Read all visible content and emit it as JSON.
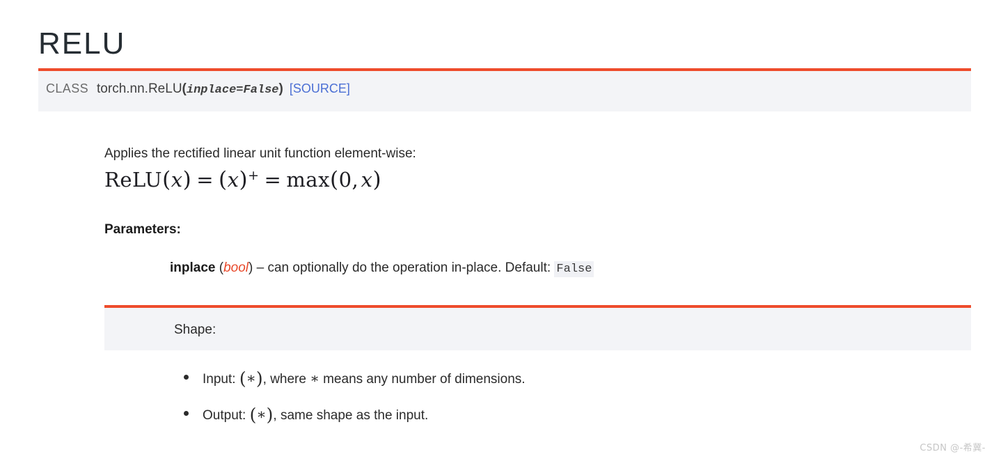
{
  "page": {
    "title": "RELU"
  },
  "signature": {
    "keyword": "CLASS",
    "path": "torch.nn.ReLU",
    "paren_open": "(",
    "argument": "inplace=False",
    "paren_close": ")",
    "source_link": "[SOURCE]"
  },
  "body": {
    "description": "Applies the rectified linear unit function element-wise:",
    "formula": {
      "lhs": "ReLU",
      "lhs_paren_open": "(",
      "lhs_var": "x",
      "lhs_paren_close": ")",
      "eq1": "=",
      "mid_paren_open": "(",
      "mid_var": "x",
      "mid_paren_close": ")",
      "mid_sup": "+",
      "eq2": "=",
      "rhs_fn": "max",
      "rhs_paren_open": "(",
      "rhs_zero": "0,",
      "rhs_var": "x",
      "rhs_paren_close": ")",
      "plain": "ReLU(x) = (x)+ = max(0, x)"
    },
    "parameters_label": "Parameters:",
    "parameters": [
      {
        "name": "inplace",
        "type_open": "(",
        "type": "bool",
        "type_close": ")",
        "separator": "–",
        "description": "can optionally do the operation in-place. Default:",
        "default_value": "False"
      }
    ]
  },
  "shape": {
    "title": "Shape:",
    "items": [
      {
        "label": "Input:",
        "paren_open": "(",
        "symbol": "∗",
        "paren_close": ")",
        "rest_a": ", where",
        "rest_symbol": "∗",
        "rest_b": "means any number of dimensions."
      },
      {
        "label": "Output:",
        "paren_open": "(",
        "symbol": "∗",
        "paren_close": ")",
        "rest_a": ", same shape as the input.",
        "rest_symbol": "",
        "rest_b": ""
      }
    ]
  },
  "watermark": {
    "text": "CSDN @-希冀-"
  },
  "colors": {
    "accent": "#ee4c2c",
    "block_background": "#f3f4f7",
    "link": "#4b6fd4",
    "type_red": "#e8482a",
    "text": "#2b2b2b"
  }
}
